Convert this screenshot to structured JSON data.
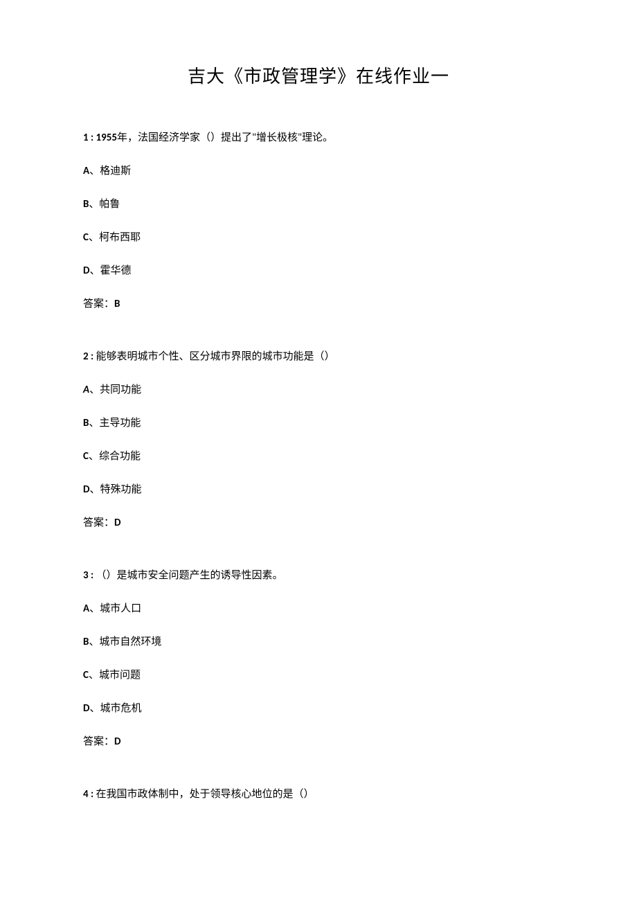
{
  "title": "吉大《市政管理学》在线作业一",
  "questions": [
    {
      "num": "1 : 1955",
      "numSuffix": "年，法国经济学家（）提出了\"增长极核\"理论。",
      "opts": [
        {
          "letter": "A",
          "text": "、格迪斯"
        },
        {
          "letter": "B",
          "text": "、帕鲁"
        },
        {
          "letter": "C",
          "text": "、柯布西耶"
        },
        {
          "letter": "D",
          "text": "、霍华德"
        }
      ],
      "ansLabel": "答案：",
      "ansLetter": "B"
    },
    {
      "num": "2 : ",
      "numSuffix": "能够表明城市个性、区分城市界限的城市功能是（）",
      "opts": [
        {
          "letter": "A",
          "text": "、共同功能",
          "italic": true
        },
        {
          "letter": "B",
          "text": "、主导功能"
        },
        {
          "letter": "C",
          "text": "、综合功能"
        },
        {
          "letter": "D",
          "text": "、特殊功能"
        }
      ],
      "ansLabel": "答案：",
      "ansLetter": "D"
    },
    {
      "num": "3 : ",
      "numSuffix": "（）是城市安全问题产生的诱导性因素。",
      "opts": [
        {
          "letter": "A",
          "text": "、城市人口"
        },
        {
          "letter": "B",
          "text": "、城市自然环境"
        },
        {
          "letter": "C",
          "text": "、城市问题"
        },
        {
          "letter": "D",
          "text": "、城市危机"
        }
      ],
      "ansLabel": "答案：",
      "ansLetter": "D"
    },
    {
      "num": "4 : ",
      "numSuffix": "在我国市政体制中，处于领导核心地位的是（）",
      "opts": [],
      "ansLabel": "",
      "ansLetter": ""
    }
  ]
}
